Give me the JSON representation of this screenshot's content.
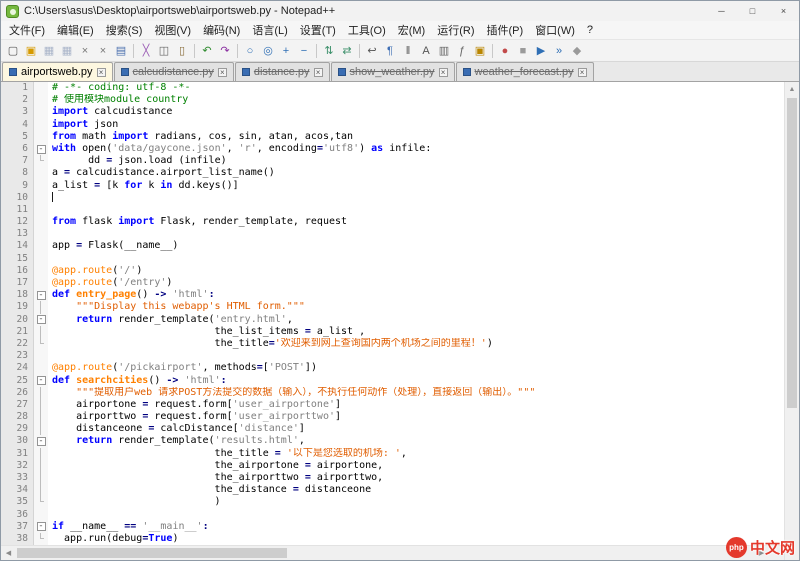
{
  "window": {
    "title": "C:\\Users\\asus\\Desktop\\airportsweb\\airportsweb.py - Notepad++",
    "controls": {
      "minimize": "─",
      "maximize": "□",
      "close": "×"
    }
  },
  "menu": {
    "items": [
      "文件(F)",
      "编辑(E)",
      "搜索(S)",
      "视图(V)",
      "编码(N)",
      "语言(L)",
      "设置(T)",
      "工具(O)",
      "宏(M)",
      "运行(R)",
      "插件(P)",
      "窗口(W)",
      "?"
    ]
  },
  "toolbar": {
    "icons": [
      {
        "name": "new-file-icon",
        "glyph": "▢",
        "color": "#555555"
      },
      {
        "name": "open-file-icon",
        "glyph": "▣",
        "color": "#d69a00"
      },
      {
        "name": "save-icon",
        "glyph": "▦",
        "color": "#a9b4c9"
      },
      {
        "name": "save-all-icon",
        "glyph": "▦",
        "color": "#a9b4c9"
      },
      {
        "name": "close-doc-icon",
        "glyph": "×",
        "color": "#777777"
      },
      {
        "name": "close-all-icon",
        "glyph": "×",
        "color": "#777777"
      },
      {
        "name": "print-icon",
        "glyph": "▤",
        "color": "#4a6fae"
      },
      {
        "sep": true
      },
      {
        "name": "cut-icon",
        "glyph": "╳",
        "color": "#9a5bb5"
      },
      {
        "name": "copy-icon",
        "glyph": "◫",
        "color": "#666666"
      },
      {
        "name": "paste-icon",
        "glyph": "▯",
        "color": "#8a6d3b"
      },
      {
        "sep": true
      },
      {
        "name": "undo-icon",
        "glyph": "↶",
        "color": "#2e8b2e"
      },
      {
        "name": "redo-icon",
        "glyph": "↷",
        "color": "#8a2ea0"
      },
      {
        "sep": true
      },
      {
        "name": "find-icon",
        "glyph": "○",
        "color": "#2f6fb5"
      },
      {
        "name": "replace-icon",
        "glyph": "◎",
        "color": "#2f6fb5"
      },
      {
        "name": "zoom-in-icon",
        "glyph": "+",
        "color": "#2f6fb5"
      },
      {
        "name": "zoom-out-icon",
        "glyph": "−",
        "color": "#2f6fb5"
      },
      {
        "sep": true
      },
      {
        "name": "sync-vertical-icon",
        "glyph": "⇅",
        "color": "#3b8f6a"
      },
      {
        "name": "sync-horizontal-icon",
        "glyph": "⇄",
        "color": "#3b8f6a"
      },
      {
        "sep": true
      },
      {
        "name": "word-wrap-icon",
        "glyph": "↩",
        "color": "#555555"
      },
      {
        "name": "show-all-chars-icon",
        "glyph": "¶",
        "color": "#3f6fb5"
      },
      {
        "name": "indent-guide-icon",
        "glyph": "‖",
        "color": "#555555"
      },
      {
        "name": "define-language-icon",
        "glyph": "A",
        "color": "#555555"
      },
      {
        "name": "doc-map-icon",
        "glyph": "▥",
        "color": "#666666"
      },
      {
        "name": "function-list-icon",
        "glyph": "ƒ",
        "color": "#666666"
      },
      {
        "name": "folder-workspace-icon",
        "glyph": "▣",
        "color": "#b98600"
      },
      {
        "sep": true
      },
      {
        "name": "record-macro-icon",
        "glyph": "●",
        "color": "#c24a4a"
      },
      {
        "name": "stop-macro-icon",
        "glyph": "■",
        "color": "#9a9a9a"
      },
      {
        "name": "play-macro-icon",
        "glyph": "▶",
        "color": "#2f6fb5"
      },
      {
        "name": "run-multiple-icon",
        "glyph": "»",
        "color": "#2f6fb5"
      },
      {
        "name": "save-macro-icon",
        "glyph": "◆",
        "color": "#9a9a9a"
      }
    ]
  },
  "tabs": [
    {
      "label": "airportsweb.py",
      "active": true
    },
    {
      "label": "calcudistance.py",
      "active": false
    },
    {
      "label": "distance.py",
      "active": false
    },
    {
      "label": "show_weather.py",
      "active": false
    },
    {
      "label": "weather_forecast.py",
      "active": false
    }
  ],
  "editor": {
    "caret_line": 10,
    "lines": [
      {
        "n": 1,
        "fold": null,
        "segs": [
          [
            "c",
            "# -*- coding: utf-8 -*-"
          ]
        ]
      },
      {
        "n": 2,
        "fold": null,
        "segs": [
          [
            "c",
            "# 使用模块module country"
          ]
        ]
      },
      {
        "n": 3,
        "fold": null,
        "segs": [
          [
            "k",
            "import"
          ],
          [
            "p",
            " calcudistance"
          ]
        ]
      },
      {
        "n": 4,
        "fold": null,
        "segs": [
          [
            "k",
            "import"
          ],
          [
            "p",
            " json"
          ]
        ]
      },
      {
        "n": 5,
        "fold": null,
        "segs": [
          [
            "k",
            "from"
          ],
          [
            "p",
            " math "
          ],
          [
            "k",
            "import"
          ],
          [
            "p",
            " radians, cos, sin, atan, acos,tan"
          ]
        ]
      },
      {
        "n": 6,
        "fold": "box",
        "segs": [
          [
            "k",
            "with"
          ],
          [
            "p",
            " open("
          ],
          [
            "s",
            "'data/gaycone.json'"
          ],
          [
            "p",
            ", "
          ],
          [
            "s",
            "'r'"
          ],
          [
            "p",
            ", encoding"
          ],
          [
            "o",
            "="
          ],
          [
            "s",
            "'utf8'"
          ],
          [
            "p",
            ") "
          ],
          [
            "k",
            "as"
          ],
          [
            "p",
            " infile:"
          ]
        ]
      },
      {
        "n": 7,
        "fold": "corner",
        "segs": [
          [
            "p",
            "      dd "
          ],
          [
            "o",
            "="
          ],
          [
            "p",
            " json.load (infile)"
          ]
        ]
      },
      {
        "n": 8,
        "fold": null,
        "segs": [
          [
            "p",
            "a "
          ],
          [
            "o",
            "="
          ],
          [
            "p",
            " calcudistance.airport_list_name()"
          ]
        ]
      },
      {
        "n": 9,
        "fold": null,
        "segs": [
          [
            "p",
            "a_list "
          ],
          [
            "o",
            "="
          ],
          [
            "p",
            " [k "
          ],
          [
            "k",
            "for"
          ],
          [
            "p",
            " k "
          ],
          [
            "k",
            "in"
          ],
          [
            "p",
            " dd.keys()]"
          ]
        ]
      },
      {
        "n": 10,
        "fold": null,
        "segs": []
      },
      {
        "n": 11,
        "fold": null,
        "segs": []
      },
      {
        "n": 12,
        "fold": null,
        "segs": [
          [
            "k",
            "from"
          ],
          [
            "p",
            " flask "
          ],
          [
            "k",
            "import"
          ],
          [
            "p",
            " Flask, render_template, request"
          ]
        ]
      },
      {
        "n": 13,
        "fold": null,
        "segs": []
      },
      {
        "n": 14,
        "fold": null,
        "segs": [
          [
            "p",
            "app "
          ],
          [
            "o",
            "="
          ],
          [
            "p",
            " Flask(__name__)"
          ]
        ]
      },
      {
        "n": 15,
        "fold": null,
        "segs": []
      },
      {
        "n": 16,
        "fold": null,
        "segs": [
          [
            "d",
            "@app.route"
          ],
          [
            "p",
            "("
          ],
          [
            "s",
            "'/'"
          ],
          [
            "p",
            ")"
          ]
        ]
      },
      {
        "n": 17,
        "fold": null,
        "segs": [
          [
            "d",
            "@app.route"
          ],
          [
            "p",
            "("
          ],
          [
            "s",
            "'/entry'"
          ],
          [
            "p",
            ")"
          ]
        ]
      },
      {
        "n": 18,
        "fold": "box",
        "segs": [
          [
            "k",
            "def"
          ],
          [
            "f",
            " entry_page"
          ],
          [
            "p",
            "() "
          ],
          [
            "o",
            "->"
          ],
          [
            "p",
            " "
          ],
          [
            "s",
            "'html'"
          ],
          [
            "o",
            ":"
          ]
        ]
      },
      {
        "n": 19,
        "fold": "line",
        "segs": [
          [
            "t",
            "    \"\"\"Display this webapp's HTML form.\"\"\""
          ]
        ]
      },
      {
        "n": 20,
        "fold": "box",
        "segs": [
          [
            "p",
            "    "
          ],
          [
            "k",
            "return"
          ],
          [
            "p",
            " render_template("
          ],
          [
            "s",
            "'entry.html'"
          ],
          [
            "p",
            ","
          ]
        ]
      },
      {
        "n": 21,
        "fold": "line",
        "segs": [
          [
            "p",
            "                           the_list_items "
          ],
          [
            "o",
            "="
          ],
          [
            "p",
            " a_list ,"
          ]
        ]
      },
      {
        "n": 22,
        "fold": "corner",
        "segs": [
          [
            "p",
            "                           the_title"
          ],
          [
            "o",
            "="
          ],
          [
            "t",
            "'欢迎来到网上查询国内两个机场之间的里程！'"
          ],
          [
            "p",
            ")"
          ]
        ]
      },
      {
        "n": 23,
        "fold": null,
        "segs": []
      },
      {
        "n": 24,
        "fold": null,
        "segs": [
          [
            "d",
            "@app.route"
          ],
          [
            "p",
            "("
          ],
          [
            "s",
            "'/pickairport'"
          ],
          [
            "p",
            ", methods"
          ],
          [
            "o",
            "="
          ],
          [
            "p",
            "["
          ],
          [
            "s",
            "'POST'"
          ],
          [
            "p",
            "])"
          ]
        ]
      },
      {
        "n": 25,
        "fold": "box",
        "segs": [
          [
            "k",
            "def"
          ],
          [
            "f",
            " searchcities"
          ],
          [
            "p",
            "() "
          ],
          [
            "o",
            "->"
          ],
          [
            "p",
            " "
          ],
          [
            "s",
            "'html'"
          ],
          [
            "o",
            ":"
          ]
        ]
      },
      {
        "n": 26,
        "fold": "line",
        "segs": [
          [
            "t",
            "    \"\"\"提取用户web 请求POST方法提交的数据（输入），不执行任何动作（处理），直接返回（输出）。\"\"\""
          ]
        ]
      },
      {
        "n": 27,
        "fold": "line",
        "segs": [
          [
            "p",
            "    airportone "
          ],
          [
            "o",
            "="
          ],
          [
            "p",
            " request.form["
          ],
          [
            "s",
            "'user_airportone'"
          ],
          [
            "p",
            "]"
          ]
        ]
      },
      {
        "n": 28,
        "fold": "line",
        "segs": [
          [
            "p",
            "    airporttwo "
          ],
          [
            "o",
            "="
          ],
          [
            "p",
            " request.form["
          ],
          [
            "s",
            "'user_airporttwo'"
          ],
          [
            "p",
            "]"
          ]
        ]
      },
      {
        "n": 29,
        "fold": "line",
        "segs": [
          [
            "p",
            "    distanceone "
          ],
          [
            "o",
            "="
          ],
          [
            "p",
            " calcDistance["
          ],
          [
            "s",
            "'distance'"
          ],
          [
            "p",
            "]"
          ]
        ]
      },
      {
        "n": 30,
        "fold": "box",
        "segs": [
          [
            "p",
            "    "
          ],
          [
            "k",
            "return"
          ],
          [
            "p",
            " render_template("
          ],
          [
            "s",
            "'results.html'"
          ],
          [
            "p",
            ","
          ]
        ]
      },
      {
        "n": 31,
        "fold": "line",
        "segs": [
          [
            "p",
            "                           the_title "
          ],
          [
            "o",
            "="
          ],
          [
            "p",
            " "
          ],
          [
            "t",
            "'以下是您选取的机场: '"
          ],
          [
            "p",
            ","
          ]
        ]
      },
      {
        "n": 32,
        "fold": "line",
        "segs": [
          [
            "p",
            "                           the_airportone "
          ],
          [
            "o",
            "="
          ],
          [
            "p",
            " airportone,"
          ]
        ]
      },
      {
        "n": 33,
        "fold": "line",
        "segs": [
          [
            "p",
            "                           the_airporttwo "
          ],
          [
            "o",
            "="
          ],
          [
            "p",
            " airporttwo,"
          ]
        ]
      },
      {
        "n": 34,
        "fold": "line",
        "segs": [
          [
            "p",
            "                           the_distance "
          ],
          [
            "o",
            "="
          ],
          [
            "p",
            " distanceone"
          ]
        ]
      },
      {
        "n": 35,
        "fold": "corner",
        "segs": [
          [
            "p",
            "                           )"
          ]
        ]
      },
      {
        "n": 36,
        "fold": null,
        "segs": []
      },
      {
        "n": 37,
        "fold": "box",
        "segs": [
          [
            "k",
            "if"
          ],
          [
            "p",
            " __name__ "
          ],
          [
            "o",
            "=="
          ],
          [
            "p",
            " "
          ],
          [
            "s",
            "'__main__'"
          ],
          [
            "o",
            ":"
          ]
        ]
      },
      {
        "n": 38,
        "fold": "corner",
        "segs": [
          [
            "p",
            "  app.run(debug"
          ],
          [
            "o",
            "="
          ],
          [
            "k",
            "True"
          ],
          [
            "p",
            ")"
          ]
        ]
      }
    ]
  },
  "watermark": {
    "badge": "php",
    "text": "中文网"
  }
}
